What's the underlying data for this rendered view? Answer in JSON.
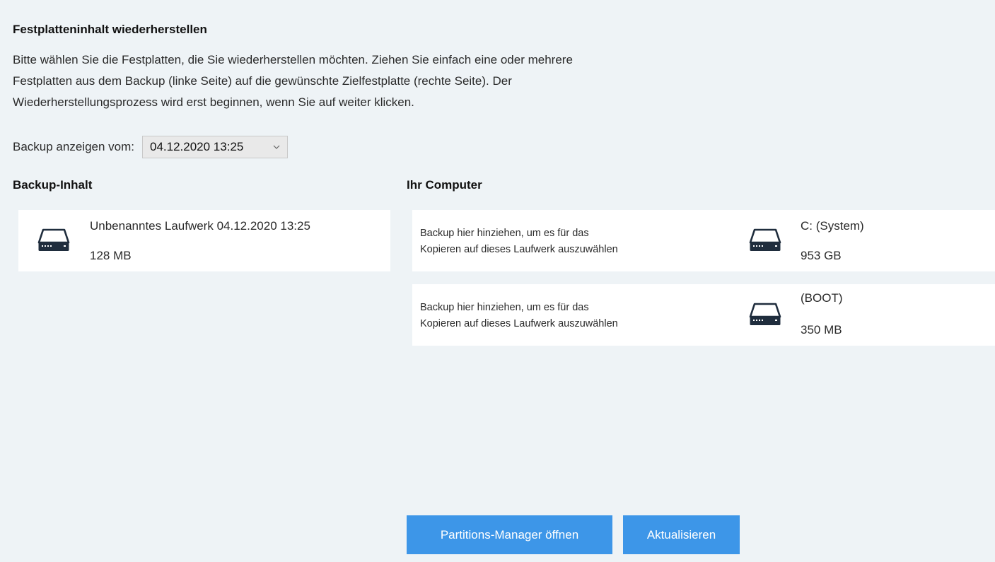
{
  "header": {
    "title": "Festplatteninhalt wiederherstellen",
    "description_lines": [
      "Bitte wählen Sie die Festplatten, die Sie wiederherstellen möchten. Ziehen Sie einfach eine oder mehrere",
      "Festplatten aus dem Backup (linke Seite) auf die gewünschte Zielfestplatte (rechte Seite). Der",
      "Wiederherstellungsprozess wird erst  beginnen, wenn Sie auf weiter klicken."
    ]
  },
  "backup_selector": {
    "label": "Backup anzeigen vom:",
    "selected_value": "04.12.2020 13:25",
    "icon": "chevron-down-icon"
  },
  "backup_content": {
    "heading": "Backup-Inhalt",
    "drives": [
      {
        "name": "Unbenanntes Laufwerk 04.12.2020 13:25",
        "size": "128 MB",
        "icon": "hard-drive-icon"
      }
    ]
  },
  "computer": {
    "heading": "Ihr Computer",
    "drives": [
      {
        "drop_hint_lines": [
          "Backup hier hinziehen, um es für das",
          "Kopieren auf dieses Laufwerk auszuwählen"
        ],
        "name": "C: (System)",
        "size": "953 GB",
        "icon": "hard-drive-icon"
      },
      {
        "drop_hint_lines": [
          "Backup hier hinziehen, um es für das",
          "Kopieren auf dieses Laufwerk auszuwählen"
        ],
        "name": "(BOOT)",
        "size": "350 MB",
        "icon": "hard-drive-icon"
      }
    ]
  },
  "actions": {
    "partition_manager_label": "Partitions-Manager öffnen",
    "refresh_label": "Aktualisieren"
  },
  "colors": {
    "background": "#eef3f6",
    "card": "#ffffff",
    "button": "#3d96e8",
    "button_text": "#ffffff"
  }
}
